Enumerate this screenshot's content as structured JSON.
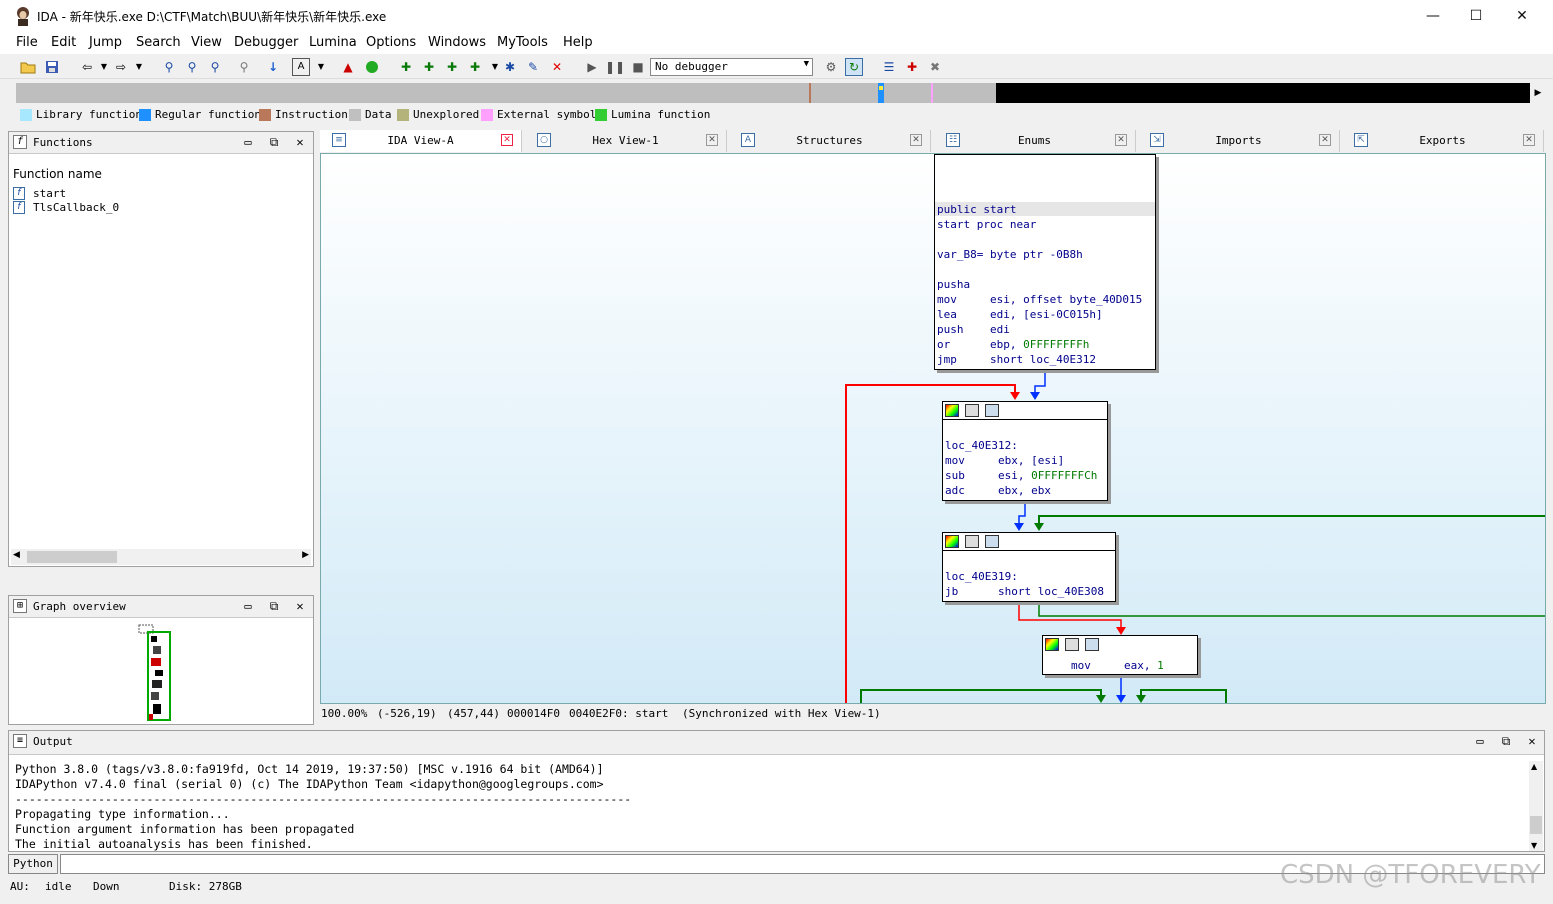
{
  "window": {
    "title": "IDA - 新年快乐.exe D:\\CTF\\Match\\BUU\\新年快乐\\新年快乐.exe",
    "minimize": "—",
    "maximize": "☐",
    "close": "✕"
  },
  "menu": [
    "File",
    "Edit",
    "Jump",
    "Search",
    "View",
    "Debugger",
    "Lumina",
    "Options",
    "Windows",
    "MyTools",
    "Help"
  ],
  "toolbar": {
    "debugger_select": "No debugger"
  },
  "legend": [
    {
      "label": "Library function",
      "color": "#a8e8ff"
    },
    {
      "label": "Regular function",
      "color": "#1e90ff"
    },
    {
      "label": "Instruction",
      "color": "#b9785a"
    },
    {
      "label": "Data",
      "color": "#c0c0c0"
    },
    {
      "label": "Unexplored",
      "color": "#b4b47a"
    },
    {
      "label": "External symbol",
      "color": "#ffa0ff"
    },
    {
      "label": "Lumina function",
      "color": "#32cd32"
    }
  ],
  "functions_panel": {
    "title": "Functions",
    "column": "Function name",
    "items": [
      "start",
      "TlsCallback_0"
    ]
  },
  "graph_overview": {
    "title": "Graph overview"
  },
  "tabs": [
    {
      "label": "IDA View-A",
      "icon": "disasm-icon"
    },
    {
      "label": "Hex View-1",
      "icon": "hex-icon"
    },
    {
      "label": "Structures",
      "icon": "struct-icon"
    },
    {
      "label": "Enums",
      "icon": "enum-icon"
    },
    {
      "label": "Imports",
      "icon": "imports-icon"
    },
    {
      "label": "Exports",
      "icon": "exports-icon"
    }
  ],
  "graph": {
    "node1": {
      "lines": [
        "public start",
        "start proc near",
        "",
        "var_B8= byte ptr -0B8h",
        "",
        "pusha",
        "mov     esi, offset byte_40D015",
        "lea     edi, [esi-0C015h]",
        "push    edi",
        "or      ebp, ",
        "jmp     short loc_40E312"
      ],
      "const": "0FFFFFFFFh"
    },
    "node2": {
      "lines": [
        "loc_40E312:",
        "mov     ebx, [esi]",
        "sub     esi, ",
        "adc     ebx, ebx"
      ],
      "const": "0FFFFFFFCh"
    },
    "node3": {
      "lines": [
        "loc_40E319:",
        "jb      short loc_40E308"
      ]
    },
    "node4": {
      "line": "mov     eax, ",
      "const": "1"
    }
  },
  "status_line": [
    "100.00%",
    "(-526,19)",
    "(457,44)",
    "000014F0",
    "0040E2F0: start",
    "(Synchronized with Hex View-1)"
  ],
  "output": {
    "title": "Output",
    "lines": [
      "Python 3.8.0 (tags/v3.8.0:fa919fd, Oct 14 2019, 19:37:50) [MSC v.1916 64 bit (AMD64)]",
      "IDAPython v7.4.0 final (serial 0) (c) The IDAPython Team <idapython@googlegroups.com>",
      "-----------------------------------------------------------------------------------------",
      "Propagating type information...",
      "Function argument information has been propagated",
      "The initial autoanalysis has been finished."
    ],
    "python_button": "Python"
  },
  "statusbar": {
    "au_label": "AU:",
    "au_state": "idle",
    "direction": "Down",
    "disk": "Disk: 278GB"
  },
  "watermark": "CSDN @TFOREVERY"
}
